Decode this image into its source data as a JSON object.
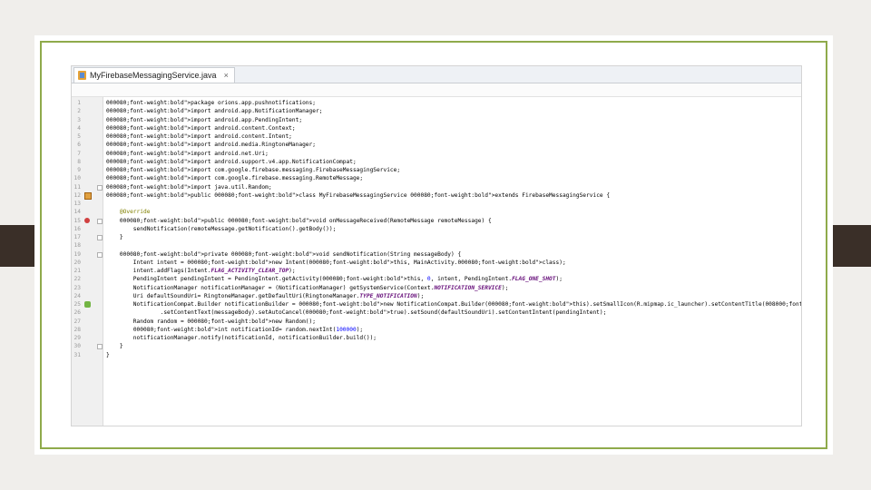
{
  "tab": {
    "filename": "MyFirebaseMessagingService.java",
    "close": "×"
  },
  "lines": [
    {
      "n": "1",
      "t": "package orions.app.pushnotifications;"
    },
    {
      "n": "2",
      "t": "import android.app.NotificationManager;"
    },
    {
      "n": "3",
      "t": "import android.app.PendingIntent;"
    },
    {
      "n": "4",
      "t": "import android.content.Context;"
    },
    {
      "n": "5",
      "t": "import android.content.Intent;"
    },
    {
      "n": "6",
      "t": "import android.media.RingtoneManager;"
    },
    {
      "n": "7",
      "t": "import android.net.Uri;"
    },
    {
      "n": "8",
      "t": "import android.support.v4.app.NotificationCompat;"
    },
    {
      "n": "9",
      "t": "import com.google.firebase.messaging.FirebaseMessagingService;"
    },
    {
      "n": "10",
      "t": "import com.google.firebase.messaging.RemoteMessage;"
    },
    {
      "n": "11",
      "t": "import java.util.Random;"
    },
    {
      "n": "12",
      "t": "public class MyFirebaseMessagingService extends FirebaseMessagingService {"
    },
    {
      "n": "13",
      "t": ""
    },
    {
      "n": "14",
      "t": "    @Override"
    },
    {
      "n": "15",
      "t": "    public void onMessageReceived(RemoteMessage remoteMessage) {"
    },
    {
      "n": "16",
      "t": "        sendNotification(remoteMessage.getNotification().getBody());"
    },
    {
      "n": "17",
      "t": "    }"
    },
    {
      "n": "18",
      "t": ""
    },
    {
      "n": "19",
      "t": "    private void sendNotification(String messageBody) {"
    },
    {
      "n": "20",
      "t": "        Intent intent = new Intent(this, MainActivity.class);"
    },
    {
      "n": "21",
      "t": "        intent.addFlags(Intent.FLAG_ACTIVITY_CLEAR_TOP);"
    },
    {
      "n": "22",
      "t": "        PendingIntent pendingIntent = PendingIntent.getActivity(this, 0, intent, PendingIntent.FLAG_ONE_SHOT);"
    },
    {
      "n": "23",
      "t": "        NotificationManager notificationManager = (NotificationManager) getSystemService(Context.NOTIFICATION_SERVICE);"
    },
    {
      "n": "24",
      "t": "        Uri defaultSoundUri= RingtoneManager.getDefaultUri(RingtoneManager.TYPE_NOTIFICATION);"
    },
    {
      "n": "25",
      "t": "        NotificationCompat.Builder notificationBuilder = new NotificationCompat.Builder(this).setSmallIcon(R.mipmap.ic_launcher).setContentTitle(\"Notificacion\")"
    },
    {
      "n": "26",
      "t": "                .setContentText(messageBody).setAutoCancel(true).setSound(defaultSoundUri).setContentIntent(pendingIntent);"
    },
    {
      "n": "27",
      "t": "        Random random = new Random();"
    },
    {
      "n": "28",
      "t": "        int notificationId= random.nextInt(100000);"
    },
    {
      "n": "29",
      "t": "        notificationManager.notify(notificationId, notificationBuilder.build());"
    },
    {
      "n": "30",
      "t": "    }"
    },
    {
      "n": "31",
      "t": "}"
    }
  ],
  "colors": {
    "accent_border": "#8faa4b",
    "side_bars": "#3a2f28"
  }
}
